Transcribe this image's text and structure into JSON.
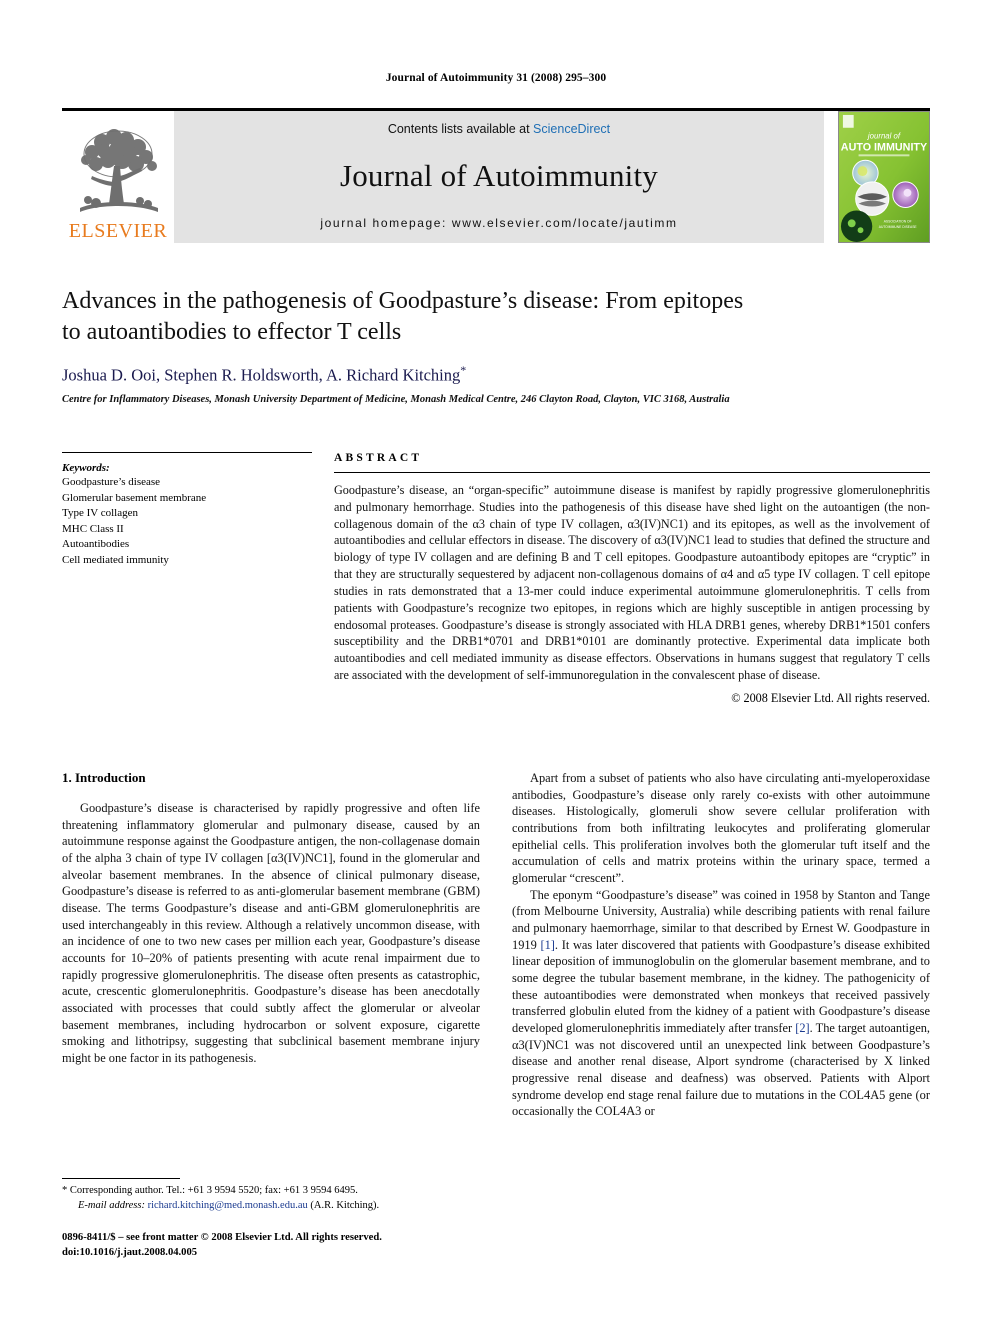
{
  "running_head": "Journal of Autoimmunity 31 (2008) 295–300",
  "masthead": {
    "publisher_wordmark": "ELSEVIER",
    "publisher_logo_icon": "elsevier-tree-icon",
    "contents_prefix": "Contents lists available at ",
    "contents_link": "ScienceDirect",
    "journal_name": "Journal of Autoimmunity",
    "homepage": "journal homepage: www.elsevier.com/locate/jautimm",
    "cover_line1": "journal of",
    "cover_line2": "AUTO IMMUNITY",
    "cover_accent": "#8cc63f"
  },
  "article": {
    "title_line1": "Advances in the pathogenesis of Goodpasture’s disease: From epitopes",
    "title_line2": "to autoantibodies to effector T cells",
    "authors": "Joshua D. Ooi, Stephen R. Holdsworth, A. Richard Kitching",
    "corresponding_marker": "*",
    "affiliation": "Centre for Inflammatory Diseases, Monash University Department of Medicine, Monash Medical Centre, 246 Clayton Road, Clayton, VIC 3168, Australia"
  },
  "keywords": {
    "heading": "Keywords:",
    "items": [
      "Goodpasture’s disease",
      "Glomerular basement membrane",
      "Type IV collagen",
      "MHC Class II",
      "Autoantibodies",
      "Cell mediated immunity"
    ]
  },
  "abstract": {
    "label": "ABSTRACT",
    "text": "Goodpasture’s disease, an “organ-specific” autoimmune disease is manifest by rapidly progressive glomerulonephritis and pulmonary hemorrhage. Studies into the pathogenesis of this disease have shed light on the autoantigen (the non-collagenous domain of the α3 chain of type IV collagen, α3(IV)NC1) and its epitopes, as well as the involvement of autoantibodies and cellular effectors in disease. The discovery of α3(IV)NC1 lead to studies that defined the structure and biology of type IV collagen and are defining B and T cell epitopes. Goodpasture autoantibody epitopes are “cryptic” in that they are structurally sequestered by adjacent non-collagenous domains of α4 and α5 type IV collagen. T cell epitope studies in rats demonstrated that a 13-mer could induce experimental autoimmune glomerulonephritis. T cells from patients with Goodpasture’s recognize two epitopes, in regions which are highly susceptible in antigen processing by endosomal proteases. Goodpasture’s disease is strongly associated with HLA DRB1 genes, whereby DRB1*1501 confers susceptibility and the DRB1*0701 and DRB1*0101 are dominantly protective. Experimental data implicate both autoantibodies and cell mediated immunity as disease effectors. Observations in humans suggest that regulatory T cells are associated with the development of self-immunoregulation in the convalescent phase of disease.",
    "copyright": "© 2008 Elsevier Ltd. All rights reserved."
  },
  "body": {
    "section_heading": "1. Introduction",
    "left_para1": "Goodpasture’s disease is characterised by rapidly progressive and often life threatening inflammatory glomerular and pulmonary disease, caused by an autoimmune response against the Goodpasture antigen, the non-collagenase domain of the alpha 3 chain of type IV collagen [α3(IV)NC1], found in the glomerular and alveolar basement membranes. In the absence of clinical pulmonary disease, Goodpasture’s disease is referred to as anti-glomerular basement membrane (GBM) disease. The terms Goodpasture’s disease and anti-GBM glomerulonephritis are used interchangeably in this review. Although a relatively uncommon disease, with an incidence of one to two new cases per million each year, Goodpasture’s disease accounts for 10–20% of patients presenting with acute renal impairment due to rapidly progressive glomerulonephritis. The disease often presents as catastrophic, acute, crescentic glomerulonephritis. Goodpasture’s disease has been anecdotally associated with processes that could subtly affect the glomerular or alveolar basement membranes, including hydrocarbon or solvent exposure, cigarette smoking and lithotripsy, suggesting that subclinical basement membrane injury might be one factor in its pathogenesis.",
    "right_para1": "Apart from a subset of patients who also have circulating anti-myeloperoxidase antibodies, Goodpasture’s disease only rarely co-exists with other autoimmune diseases. Histologically, glomeruli show severe cellular proliferation with contributions from both infiltrating leukocytes and proliferating glomerular epithelial cells. This proliferation involves both the glomerular tuft itself and the accumulation of cells and matrix proteins within the urinary space, termed a glomerular “crescent”.",
    "right_para2_a": "The eponym “Goodpasture’s disease” was coined in 1958 by Stanton and Tange (from Melbourne University, Australia) while describing patients with renal failure and pulmonary haemorrhage, similar to that described by Ernest W. Goodpasture in 1919 ",
    "right_ref1": "[1]",
    "right_para2_b": ". It was later discovered that patients with Goodpasture’s disease exhibited linear deposition of immunoglobulin on the glomerular basement membrane, and to some degree the tubular basement membrane, in the kidney. The pathogenicity of these autoantibodies were demonstrated when monkeys that received passively transferred globulin eluted from the kidney of a patient with Goodpasture’s disease developed glomerulonephritis immediately after transfer ",
    "right_ref2": "[2]",
    "right_para2_c": ". The target autoantigen, α3(IV)NC1 was not discovered until an unexpected link between Goodpasture’s disease and another renal disease, Alport syndrome (characterised by X linked progressive renal disease and deafness) was observed. Patients with Alport syndrome develop end stage renal failure due to mutations in the COL4A5 gene (or occasionally the COL4A3 or"
  },
  "footnotes": {
    "corresponding": "* Corresponding author. Tel.: +61 3 9594 5520; fax: +61 3 9594 6495.",
    "email_label": "E-mail address:",
    "email": "richard.kitching@med.monash.edu.au",
    "email_suffix": " (A.R. Kitching)."
  },
  "footer": {
    "line1": "0896-8411/$ – see front matter © 2008 Elsevier Ltd. All rights reserved.",
    "line2": "doi:10.1016/j.jaut.2008.04.005"
  }
}
